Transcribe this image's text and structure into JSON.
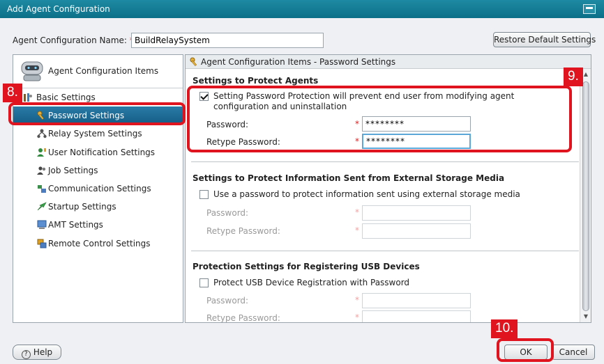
{
  "window": {
    "title": "Add Agent Configuration"
  },
  "config_name": {
    "label": "Agent Configuration Name:",
    "required_mark": "*",
    "value": "BuildRelaySystem"
  },
  "toolbar": {
    "restore_label": "Restore Default Settings"
  },
  "left_panel": {
    "title": "Agent Configuration Items",
    "items": [
      {
        "label": "Basic Settings",
        "icon": "basic-settings-icon"
      },
      {
        "label": "Password Settings",
        "icon": "key-icon",
        "selected": true
      },
      {
        "label": "Relay System Settings",
        "icon": "relay-icon"
      },
      {
        "label": "User Notification Settings",
        "icon": "user-notification-icon"
      },
      {
        "label": "Job Settings",
        "icon": "job-icon"
      },
      {
        "label": "Communication Settings",
        "icon": "communication-icon"
      },
      {
        "label": "Startup Settings",
        "icon": "startup-icon"
      },
      {
        "label": "AMT Settings",
        "icon": "amt-icon"
      },
      {
        "label": "Remote Control Settings",
        "icon": "remote-control-icon"
      }
    ]
  },
  "right_panel": {
    "header": "Agent Configuration Items - Password Settings",
    "sections": [
      {
        "title": "Settings to Protect Agents",
        "checkbox_label": "Setting Password Protection will prevent end user from modifying agent configuration and uninstallation",
        "checked": true,
        "password_label": "Password:",
        "password_value": "********",
        "retype_label": "Retype Password:",
        "retype_value": "********"
      },
      {
        "title": "Settings to Protect Information Sent from External Storage Media",
        "checkbox_label": "Use a password to protect information sent using external storage media",
        "checked": false,
        "password_label": "Password:",
        "password_value": "",
        "retype_label": "Retype Password:",
        "retype_value": ""
      },
      {
        "title": "Protection Settings for Registering USB Devices",
        "checkbox_label": "Protect USB Device Registration with Password",
        "checked": false,
        "password_label": "Password:",
        "password_value": "",
        "retype_label": "Retype Password:",
        "retype_value": ""
      }
    ]
  },
  "footer": {
    "help_label": "Help",
    "help_mark": "?",
    "ok_label": "OK",
    "cancel_label": "Cancel"
  },
  "annotations": {
    "step8": "8.",
    "step9": "9.",
    "step10": "10."
  },
  "colors": {
    "highlight": "#e0141e",
    "title_bar": "#0d6f88",
    "selection": "#1b6a96"
  }
}
